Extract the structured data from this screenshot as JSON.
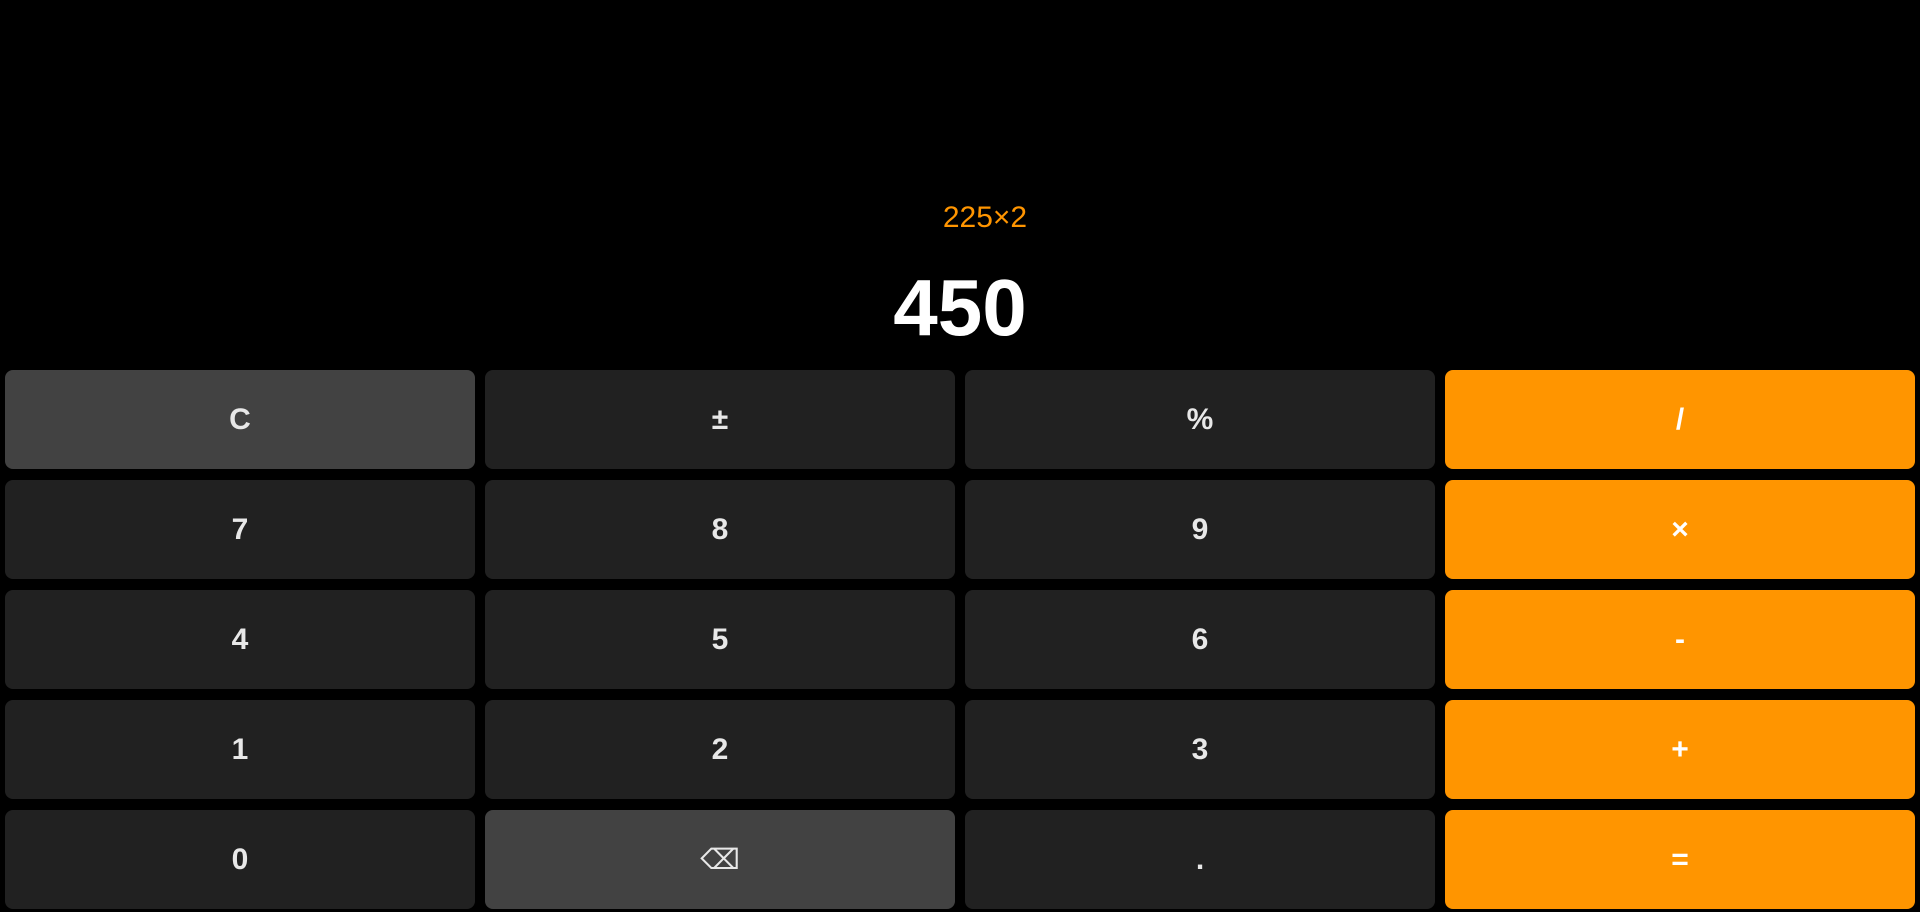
{
  "display": {
    "expression": "225×2",
    "result": "450"
  },
  "colors": {
    "background": "#000000",
    "accent": "#ff9500",
    "key_dark": "#212121",
    "key_light": "#424242"
  },
  "keys": {
    "clear": "C",
    "plus_minus": "±",
    "percent": "%",
    "divide": "/",
    "seven": "7",
    "eight": "8",
    "nine": "9",
    "multiply": "×",
    "four": "4",
    "five": "5",
    "six": "6",
    "subtract": "-",
    "one": "1",
    "two": "2",
    "three": "3",
    "add": "+",
    "zero": "0",
    "backspace": "⌫",
    "decimal": ".",
    "equals": "="
  },
  "icons": {
    "backspace": "backspace-icon"
  }
}
